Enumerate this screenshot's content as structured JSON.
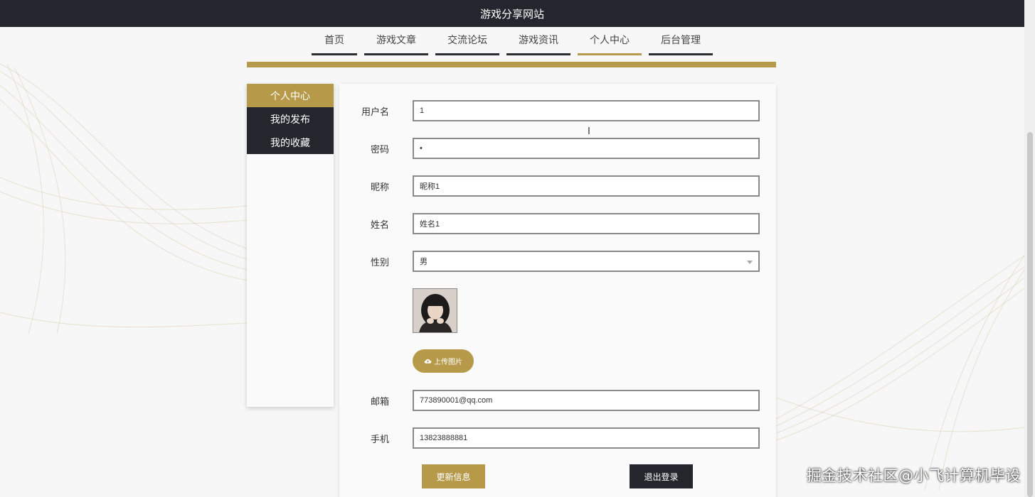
{
  "site": {
    "title": "游戏分享网站"
  },
  "nav": {
    "items": [
      {
        "label": "首页"
      },
      {
        "label": "游戏文章"
      },
      {
        "label": "交流论坛"
      },
      {
        "label": "游戏资讯"
      },
      {
        "label": "个人中心"
      },
      {
        "label": "后台管理"
      }
    ],
    "active_index": 4
  },
  "sidebar": {
    "items": [
      {
        "label": "个人中心"
      },
      {
        "label": "我的发布"
      },
      {
        "label": "我的收藏"
      }
    ],
    "active_index": 0
  },
  "form": {
    "username": {
      "label": "用户名",
      "value": "1"
    },
    "password": {
      "label": "密码",
      "value": "•"
    },
    "nickname": {
      "label": "昵称",
      "value": "昵称1"
    },
    "name": {
      "label": "姓名",
      "value": "姓名1"
    },
    "gender": {
      "label": "性别",
      "value": "男"
    },
    "upload_label": "上传图片",
    "email": {
      "label": "邮箱",
      "value": "773890001@qq.com"
    },
    "phone": {
      "label": "手机",
      "value": "13823888881"
    }
  },
  "actions": {
    "update_label": "更新信息",
    "logout_label": "退出登录"
  },
  "overlay": {
    "watermark": "掘金技术社区@小飞计算机毕设"
  },
  "colors": {
    "accent": "#b69a4a",
    "dark": "#23262d",
    "background": "#f7f7f7"
  },
  "icons": {
    "upload": "cloud-upload-icon",
    "select": "chevron-down-icon"
  }
}
